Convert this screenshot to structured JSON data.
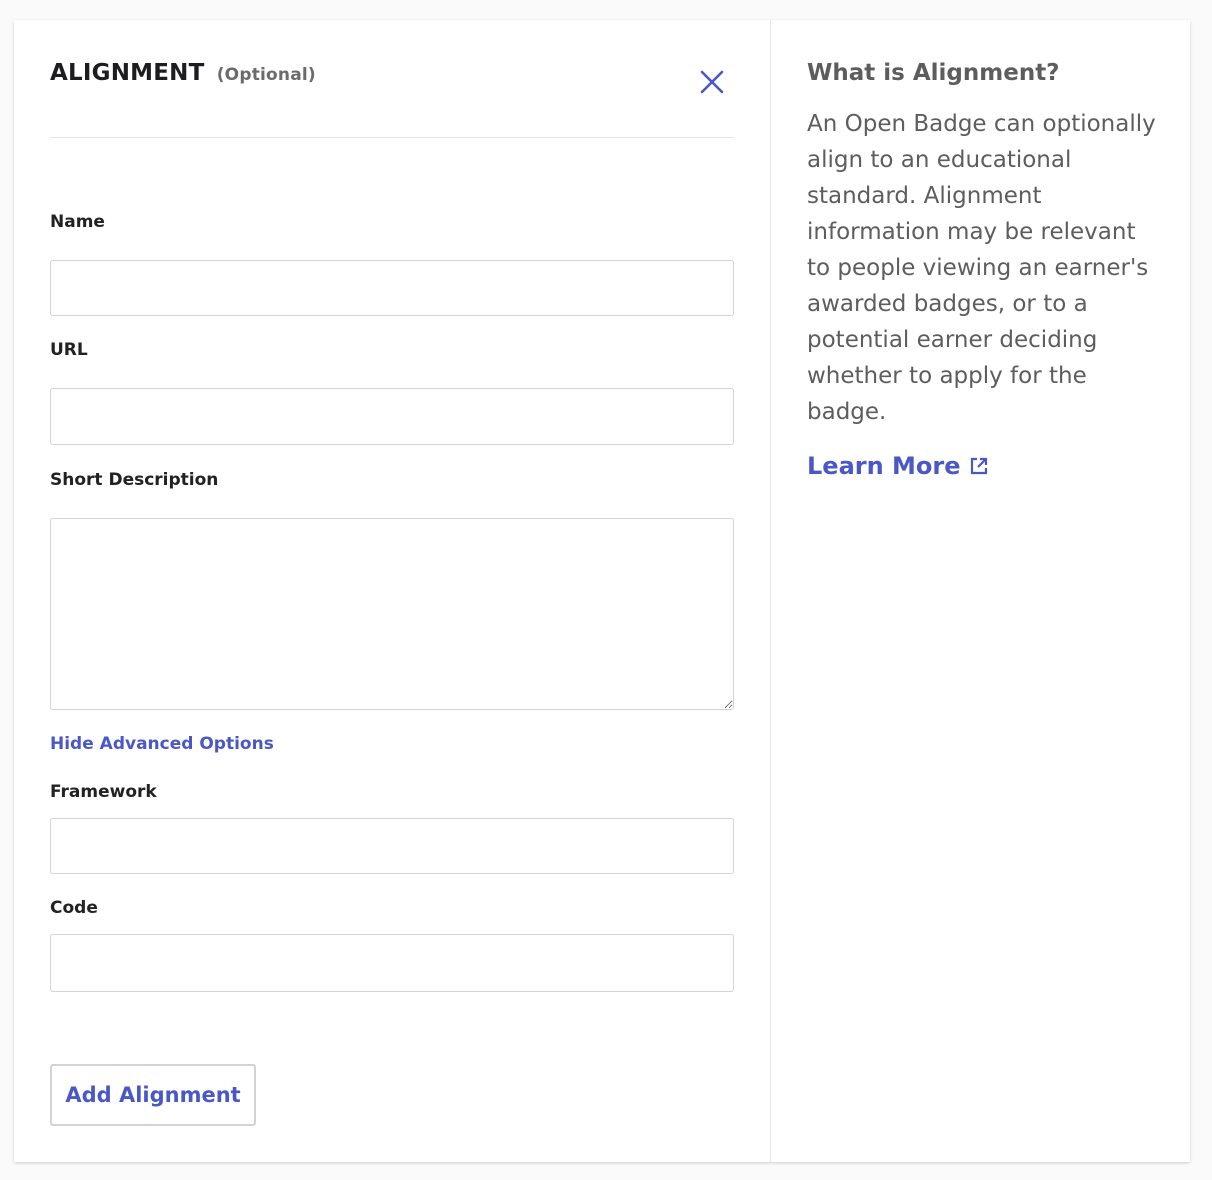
{
  "form": {
    "title": "ALIGNMENT",
    "optional_tag": "(Optional)",
    "close_icon": "close-icon",
    "fields": {
      "name": {
        "label": "Name",
        "value": "",
        "placeholder": ""
      },
      "url": {
        "label": "URL",
        "value": "",
        "placeholder": ""
      },
      "short_description": {
        "label": "Short Description",
        "value": "",
        "placeholder": ""
      },
      "framework": {
        "label": "Framework",
        "value": "",
        "placeholder": ""
      },
      "code": {
        "label": "Code",
        "value": "",
        "placeholder": ""
      }
    },
    "advanced_toggle": "Hide Advanced Options",
    "submit_label": "Add Alignment"
  },
  "info": {
    "title": "What is Alignment?",
    "body": "An Open Badge can optionally align to an educational standard. Alignment information may be relevant to people viewing an earner's awarded badges, or to a potential earner deciding whether to apply for the badge.",
    "learn_more": "Learn More",
    "external_icon": "external-link-icon"
  },
  "colors": {
    "accent": "#4a57c6",
    "text_dark": "#222222",
    "text_muted": "#5d5d5d",
    "border": "#d3d3d3"
  }
}
